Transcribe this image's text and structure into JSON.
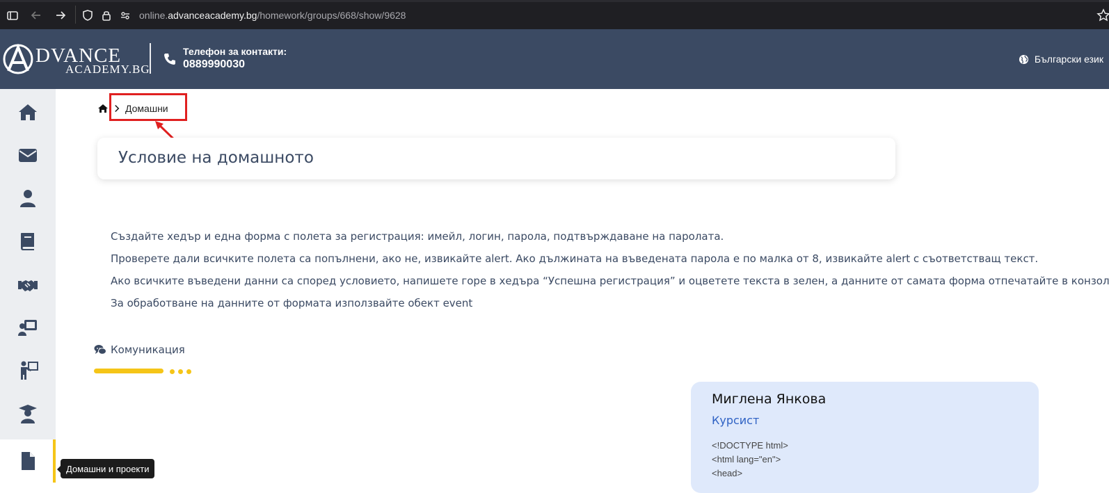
{
  "browser": {
    "url_prefix": "online.",
    "url_domain": "advanceacademy.bg",
    "url_path": "/homework/groups/668/show/9628"
  },
  "header": {
    "logo_word": "DVANCE",
    "logo_sub": "ACADEMY.BG",
    "phone_label": "Телефон за контакти:",
    "phone_number": "0889990030",
    "language": "Български език"
  },
  "sidebar": {
    "items": [
      "home-icon",
      "mail-icon",
      "user-icon",
      "book-icon",
      "handshake-icon",
      "teacher-board-icon",
      "presenter-icon",
      "graduate-icon",
      "document-icon"
    ],
    "active_index": 8,
    "tooltip": "Домашни и проекти",
    "accent": "#f5c518"
  },
  "breadcrumb": {
    "current": "Домашни"
  },
  "page": {
    "title": "Условие на домашното"
  },
  "assignment": {
    "lines": [
      "Създайте хедър и една форма с полета за регистрация: имейл, логин, парола, подтвърждаване на паролата.",
      "Проверете дали всичките полета са попълнени, ако не, извикайте alert. Ако дължината на въведената парола е по малка от 8, извикайте alert с съответстващ текст.",
      "Ако всичките въведени данни са според условието, напишете горе в хедъра “Успешна регистрация” и оцветете текста в зелен, а данните от самата форма отпечатайте в конзолата.",
      "За обработване на данните от формата използвайте обект event"
    ]
  },
  "communication": {
    "title": "Комуникация"
  },
  "message": {
    "author": "Миглена Янкова",
    "role": "Курсист",
    "code_lines": [
      "<!DOCTYPE html>",
      "<html lang=\"en\">",
      "<head>"
    ]
  },
  "colors": {
    "header_bg": "#3b4a63",
    "accent": "#f5c518",
    "message_bg": "#dfe9fb",
    "annotation": "#e02020"
  }
}
